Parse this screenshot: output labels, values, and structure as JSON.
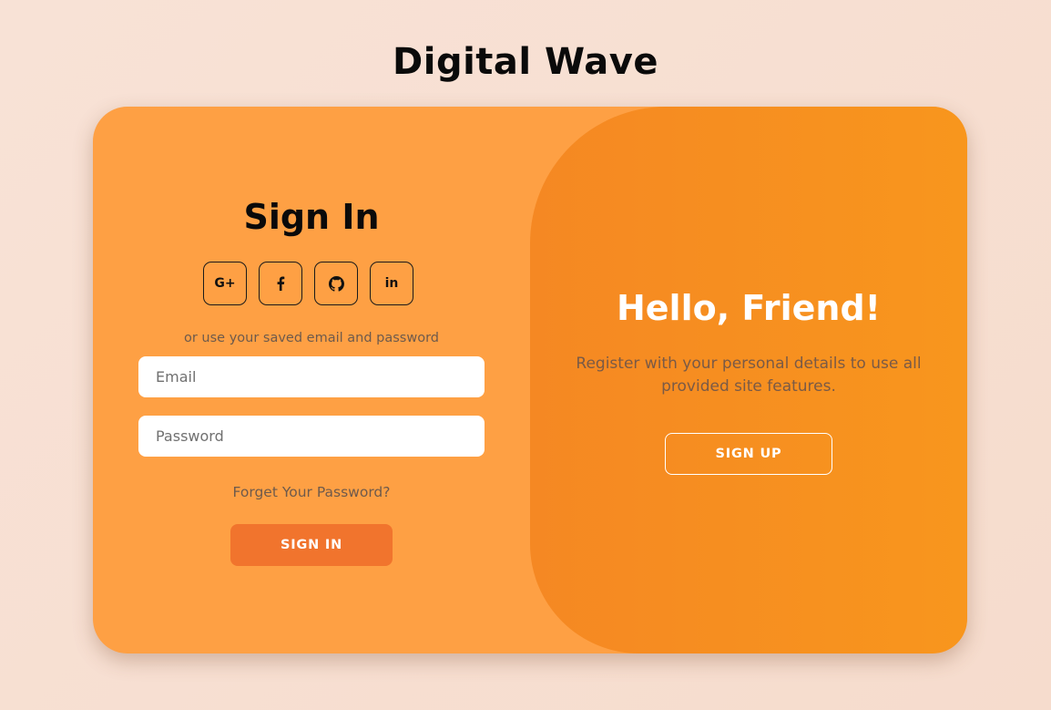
{
  "app": {
    "title": "Digital Wave"
  },
  "signin": {
    "title": "Sign In",
    "social": [
      {
        "label": "G+",
        "icon": "google-plus-icon"
      },
      {
        "label": "f",
        "icon": "facebook-icon"
      },
      {
        "label": "",
        "icon": "github-icon"
      },
      {
        "label": "in",
        "icon": "linkedin-icon"
      }
    ],
    "alt_text": "or use your saved email and password",
    "email_placeholder": "Email",
    "password_placeholder": "Password",
    "forgot_label": "Forget Your Password?",
    "submit_label": "SIGN IN"
  },
  "signup": {
    "title": "Hello, Friend!",
    "subtitle": "Register with your personal details to use all provided site features.",
    "button_label": "SIGN UP"
  },
  "colors": {
    "page_bg": "#f8e2d6",
    "card_bg": "#fea044",
    "overlay_bg": "#f58823",
    "signin_button": "#f1742d",
    "text_dark": "#0a0a0a",
    "text_white": "#ffffff"
  }
}
